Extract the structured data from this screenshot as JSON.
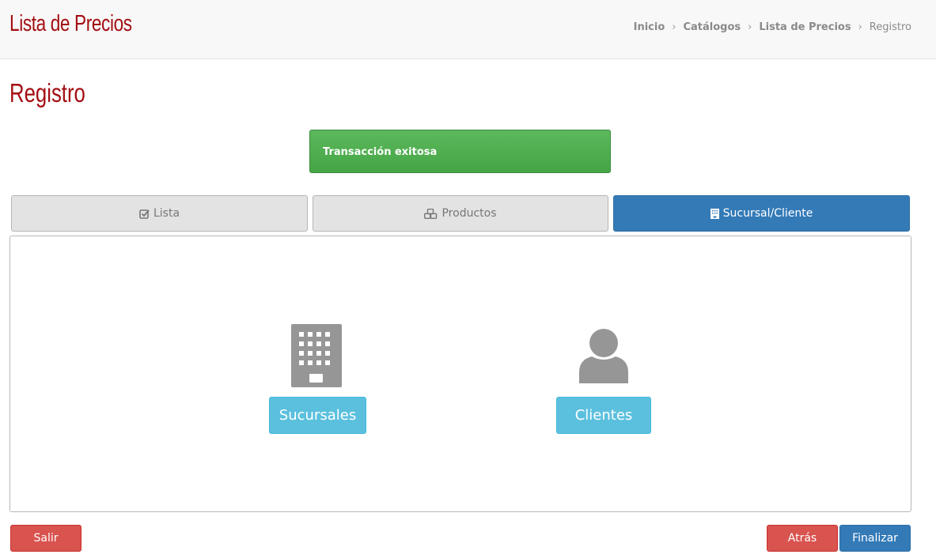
{
  "header": {
    "title": "Lista de Precios",
    "breadcrumb": [
      "Inicio",
      "Catálogos",
      "Lista de Precios",
      "Registro"
    ]
  },
  "page": {
    "title": "Registro"
  },
  "alert": {
    "message": "Transacción exitosa",
    "color": "#5cb85c"
  },
  "tabs": [
    {
      "label": "Lista",
      "icon": "checkbox-icon",
      "active": false
    },
    {
      "label": "Productos",
      "icon": "cubes-icon",
      "active": false
    },
    {
      "label": "Sucursal/Cliente",
      "icon": "building-icon",
      "active": true
    }
  ],
  "choices": {
    "sucursales": {
      "label": "Sucursales",
      "icon": "building-icon"
    },
    "clientes": {
      "label": "Clientes",
      "icon": "user-icon"
    }
  },
  "footer": {
    "salir": "Salir",
    "atras": "Atrás",
    "finalizar": "Finalizar"
  },
  "colors": {
    "brand": "#a30f13",
    "primary": "#337ab7",
    "danger": "#d9534f",
    "info": "#5bc0de",
    "success": "#5cb85c"
  }
}
